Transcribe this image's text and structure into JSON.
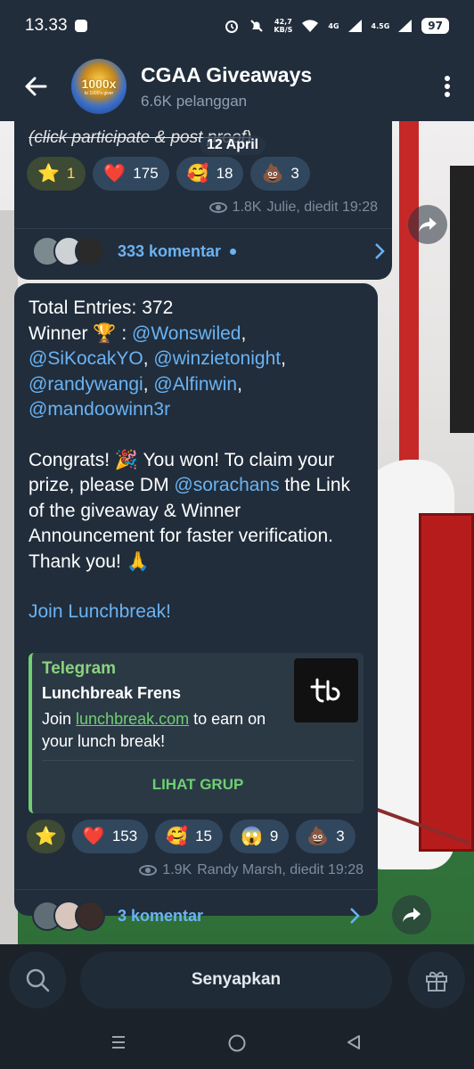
{
  "status_bar": {
    "time": "13.33",
    "net_speed": "42,7",
    "net_unit": "KB/S",
    "signal1": "4G",
    "signal2": "4.5G",
    "battery": "97"
  },
  "header": {
    "title": "CGAA Giveaways",
    "subscribers": "6.6K pelanggan",
    "logo_text": "1000x",
    "logo_sub": "to 1000's giver"
  },
  "date_pill": "12 April",
  "message1": {
    "text": "(click participate & post proof)",
    "reactions": [
      {
        "emoji": "⭐",
        "count": "1",
        "icon": "star-icon",
        "active": true
      },
      {
        "emoji": "❤️",
        "count": "175",
        "icon": "heart-icon"
      },
      {
        "emoji": "🥰",
        "count": "18",
        "icon": "smiling-face-hearts-icon"
      },
      {
        "emoji": "💩",
        "count": "3",
        "icon": "poop-icon"
      }
    ],
    "views": "1.8K",
    "author_time": "Julie, diedit 19:28",
    "comments": "333 komentar"
  },
  "message2": {
    "line1": "Total Entries: 372",
    "winner_prefix": "Winner 🏆 : ",
    "winners": [
      "@Wonswiled",
      "@SiKocakYO",
      "@winzietonight",
      "@randywangi",
      "@Alfinwin",
      "@mandoowinn3r"
    ],
    "congrats_a": "Congrats! 🎉 You won! To claim your prize, please DM ",
    "dm_user": "@sorachans",
    "congrats_b": " the Link of the giveaway & Winner Announcement for faster verification. Thank you! 🙏",
    "join_link": "Join Lunchbreak!",
    "preview": {
      "site": "Telegram",
      "title": "Lunchbreak Frens",
      "desc_a": "Join ",
      "desc_link": "lunchbreak.com",
      "desc_b": " to earn on your lunch break!",
      "button": "LIHAT GRUP"
    },
    "reactions": [
      {
        "emoji": "⭐",
        "count": "",
        "icon": "star-icon",
        "active": true
      },
      {
        "emoji": "❤️",
        "count": "153",
        "icon": "heart-icon"
      },
      {
        "emoji": "🥰",
        "count": "15",
        "icon": "smiling-face-hearts-icon"
      },
      {
        "emoji": "😱",
        "count": "9",
        "icon": "screaming-face-icon"
      },
      {
        "emoji": "💩",
        "count": "3",
        "icon": "poop-icon"
      }
    ],
    "views": "1.9K",
    "author_time": "Randy Marsh, diedit 19:28",
    "comments": "3 komentar"
  },
  "bottom": {
    "mute_label": "Senyapkan"
  },
  "colors": {
    "accent": "#6ab3f3",
    "bubble": "#212d3b",
    "preview_accent": "#6fd072"
  }
}
